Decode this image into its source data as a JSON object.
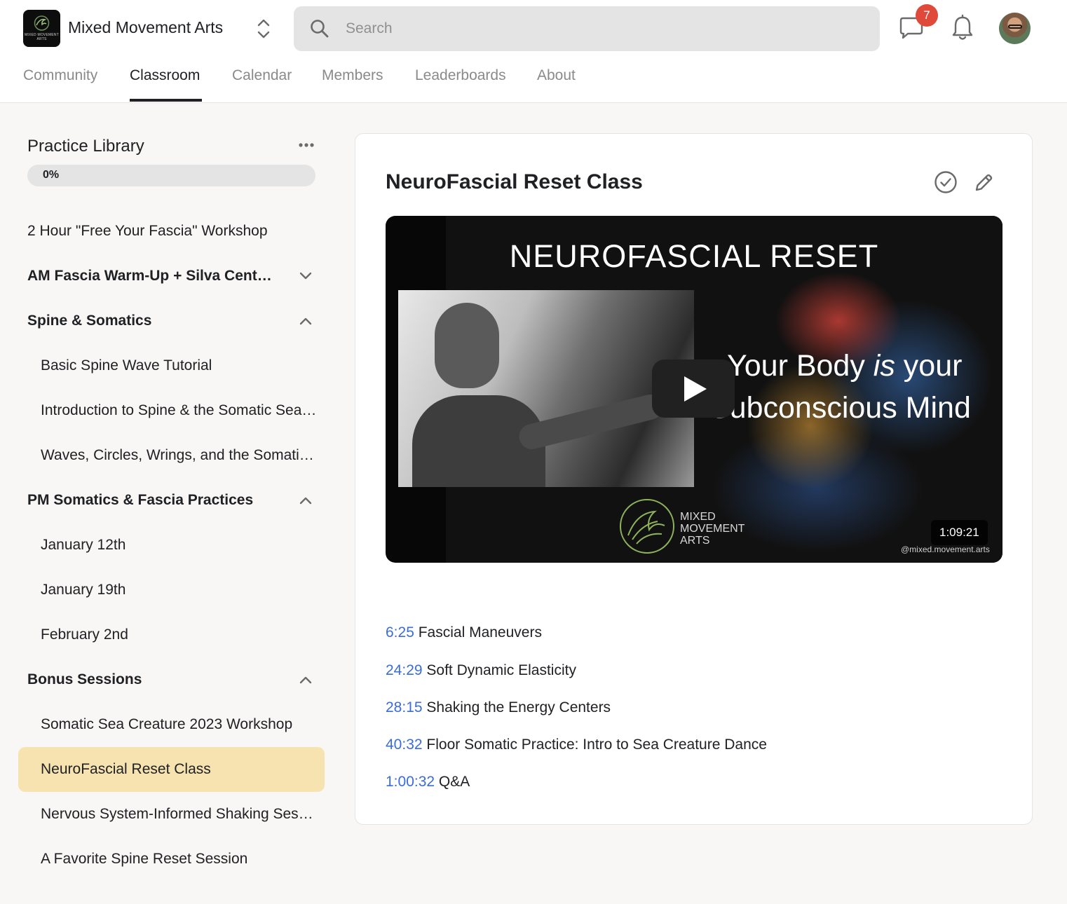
{
  "header": {
    "logo_text": "MIXED MOVEMENT ARTS",
    "group_name": "Mixed Movement Arts",
    "search": {
      "placeholder": "Search",
      "value": ""
    },
    "chat_badge_count": "7",
    "badge_color": "#e0483a"
  },
  "tabs": [
    {
      "label": "Community",
      "active": false
    },
    {
      "label": "Classroom",
      "active": true
    },
    {
      "label": "Calendar",
      "active": false
    },
    {
      "label": "Members",
      "active": false
    },
    {
      "label": "Leaderboards",
      "active": false
    },
    {
      "label": "About",
      "active": false
    }
  ],
  "sidebar": {
    "title": "Practice Library",
    "progress_label": "0%",
    "progress_value": 0,
    "items": [
      {
        "label": "2 Hour \"Free Your Fascia\" Workshop",
        "kind": "top"
      },
      {
        "label": "AM Fascia Warm-Up + Silva Centering",
        "kind": "section",
        "expanded": false
      },
      {
        "label": "Spine & Somatics",
        "kind": "section",
        "expanded": true
      },
      {
        "label": "Basic Spine Wave Tutorial",
        "kind": "child"
      },
      {
        "label": "Introduction to Spine & the Somatic Sea Creature",
        "kind": "child"
      },
      {
        "label": "Waves, Circles, Wrings, and the Somatic Sea Creature",
        "kind": "child"
      },
      {
        "label": "PM Somatics & Fascia Practices",
        "kind": "section",
        "expanded": true
      },
      {
        "label": "January 12th",
        "kind": "child"
      },
      {
        "label": "January 19th",
        "kind": "child"
      },
      {
        "label": "February 2nd",
        "kind": "child"
      },
      {
        "label": "Bonus Sessions",
        "kind": "section",
        "expanded": true
      },
      {
        "label": "Somatic Sea Creature 2023 Workshop",
        "kind": "child"
      },
      {
        "label": "NeuroFascial Reset Class",
        "kind": "child",
        "selected": true
      },
      {
        "label": "Nervous System-Informed Shaking Session",
        "kind": "child"
      },
      {
        "label": "A Favorite Spine Reset Session",
        "kind": "child"
      }
    ],
    "selected_color": "#f7e3b0"
  },
  "lesson": {
    "title": "NeuroFascial Reset Class",
    "video": {
      "heading": "NEUROFASCIAL RESET",
      "tagline_line1_a": "Your Body ",
      "tagline_line1_em": "is",
      "tagline_line1_b": " your",
      "tagline_line2": "Subconscious Mind",
      "brand_line1": "MIXED",
      "brand_line2": "MOVEMENT",
      "brand_line3": "ARTS",
      "duration": "1:09:21",
      "watermark": "@mixed.movement.arts"
    },
    "chapters": [
      {
        "time": "6:25",
        "label": "Fascial Maneuvers"
      },
      {
        "time": "24:29",
        "label": "Soft Dynamic Elasticity"
      },
      {
        "time": "28:15",
        "label": "Shaking the Energy Centers"
      },
      {
        "time": "40:32",
        "label": "Floor Somatic Practice: Intro to Sea Creature Dance"
      },
      {
        "time": "1:00:32",
        "label": "Q&A"
      }
    ],
    "timestamp_color": "#3a6dd8"
  }
}
